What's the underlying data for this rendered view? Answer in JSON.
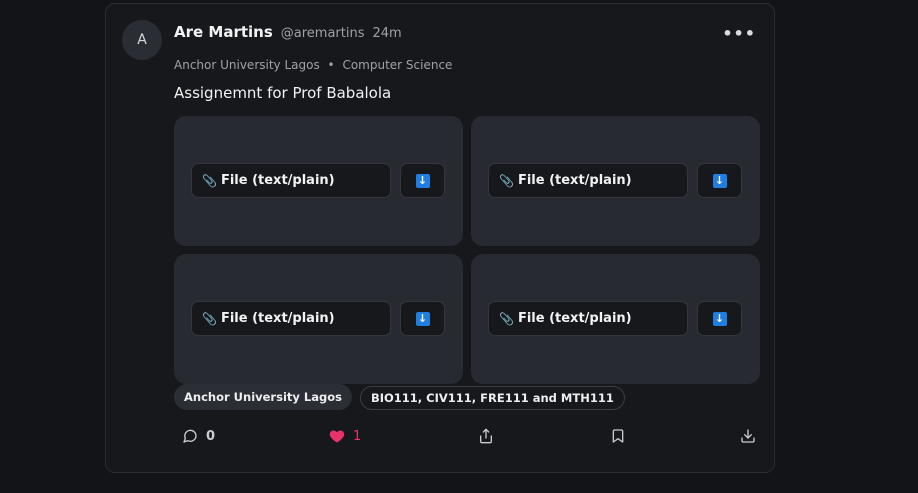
{
  "post": {
    "avatar_initial": "A",
    "author_name": "Are Martins",
    "handle": "@aremartins",
    "time": "24m",
    "more": "•••",
    "university": "Anchor University Lagos",
    "separator": "•",
    "department": "Computer Science",
    "content": "Assignemnt for Prof Babalola"
  },
  "attachments": [
    {
      "label": "File (text/plain)",
      "icon": "paperclip-icon",
      "download_icon": "download-arrow-icon"
    },
    {
      "label": "File (text/plain)",
      "icon": "paperclip-icon",
      "download_icon": "download-arrow-icon"
    },
    {
      "label": "File (text/plain)",
      "icon": "paperclip-icon",
      "download_icon": "download-arrow-icon"
    },
    {
      "label": "File (text/plain)",
      "icon": "paperclip-icon",
      "download_icon": "download-arrow-icon"
    }
  ],
  "download_glyph": "↓",
  "clip_glyph": "📎",
  "tags": [
    "Anchor University Lagos",
    "BIO111, CIV111, FRE111 and MTH111"
  ],
  "actions": {
    "comments": "0",
    "likes": "1",
    "liked": true
  },
  "colors": {
    "background": "#131417",
    "card": "#17181c",
    "tile": "#272a30",
    "like": "#e8336a",
    "download_accent": "#1f7ee0"
  }
}
